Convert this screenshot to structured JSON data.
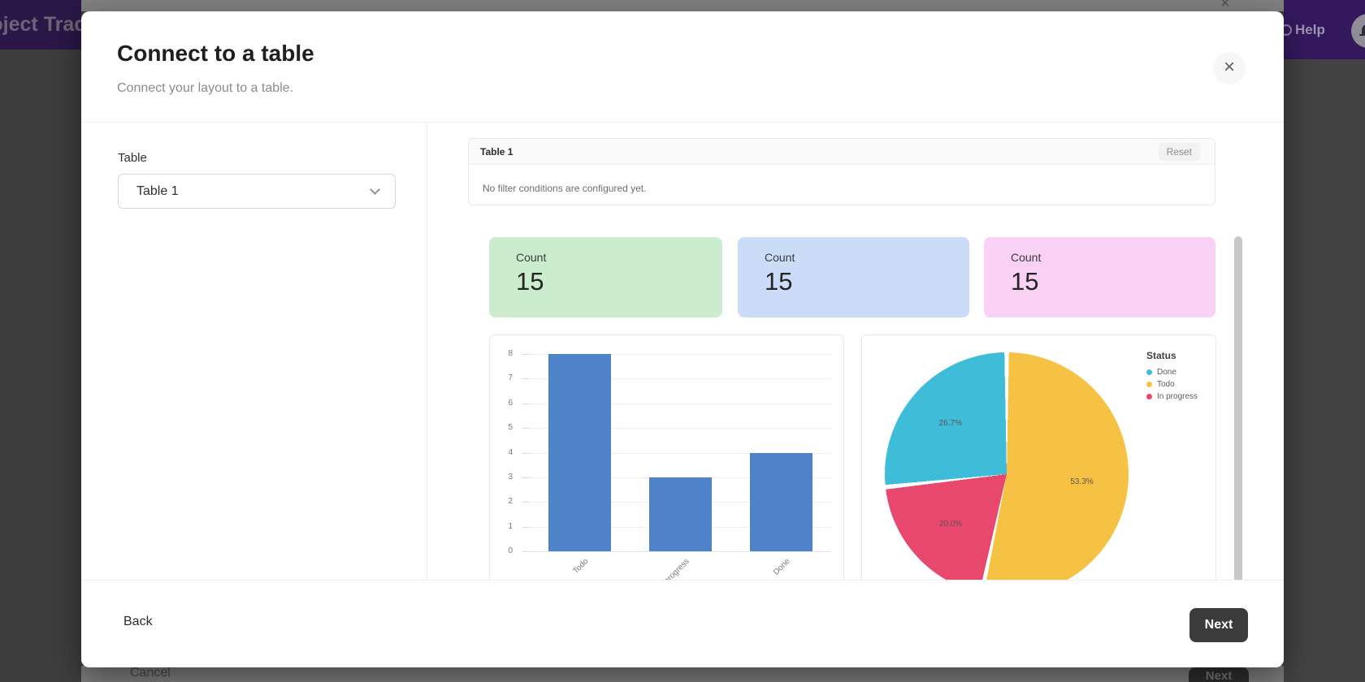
{
  "backdrop": {
    "app_title": "Project Tracker",
    "help_label": "Help",
    "behind_cancel_label": "Cancel",
    "behind_next_label": "Next",
    "close_glyph": "×",
    "header_color": "#4b2a8c"
  },
  "modal": {
    "title": "Connect to a table",
    "subtitle": "Connect your layout to a table.",
    "close_glyph": "×",
    "table_field": {
      "label": "Table",
      "value": "Table 1"
    },
    "preview": {
      "filter_card": {
        "title": "Table 1",
        "reset_label": "Reset",
        "empty_text": "No filter conditions are configured yet."
      },
      "count_cards": [
        {
          "label": "Count",
          "value": "15",
          "color": "#cbeccd"
        },
        {
          "label": "Count",
          "value": "15",
          "color": "#cbdcf8"
        },
        {
          "label": "Count",
          "value": "15",
          "color": "#f8d1f4"
        }
      ]
    },
    "footer": {
      "back_label": "Back",
      "next_label": "Next"
    }
  },
  "chart_data": [
    {
      "type": "bar",
      "categories": [
        "Todo",
        "In progress",
        "Done"
      ],
      "values": [
        8,
        3,
        4
      ],
      "title": "",
      "xlabel": "",
      "ylabel": "",
      "ylim": [
        0,
        8
      ],
      "yticks": [
        0,
        1,
        2,
        3,
        4,
        5,
        6,
        7,
        8
      ],
      "grid": true,
      "bar_color": "#4e83c9",
      "x_label_rotation": 45
    },
    {
      "type": "pie",
      "title": "",
      "legend_title": "Status",
      "legend_position": "top-right",
      "total": 15,
      "slices": [
        {
          "name": "Done",
          "value": 4,
          "pct": 26.7,
          "pct_label": "26.7%",
          "color": "#3fbcd8"
        },
        {
          "name": "Todo",
          "value": 8,
          "pct": 53.3,
          "pct_label": "53.3%",
          "color": "#f6c244"
        },
        {
          "name": "In progress",
          "value": 3,
          "pct": 20.0,
          "pct_label": "20.0%",
          "color": "#e8476e"
        }
      ],
      "clockwise_order_from_top": [
        "Todo",
        "In progress",
        "Done"
      ]
    }
  ]
}
